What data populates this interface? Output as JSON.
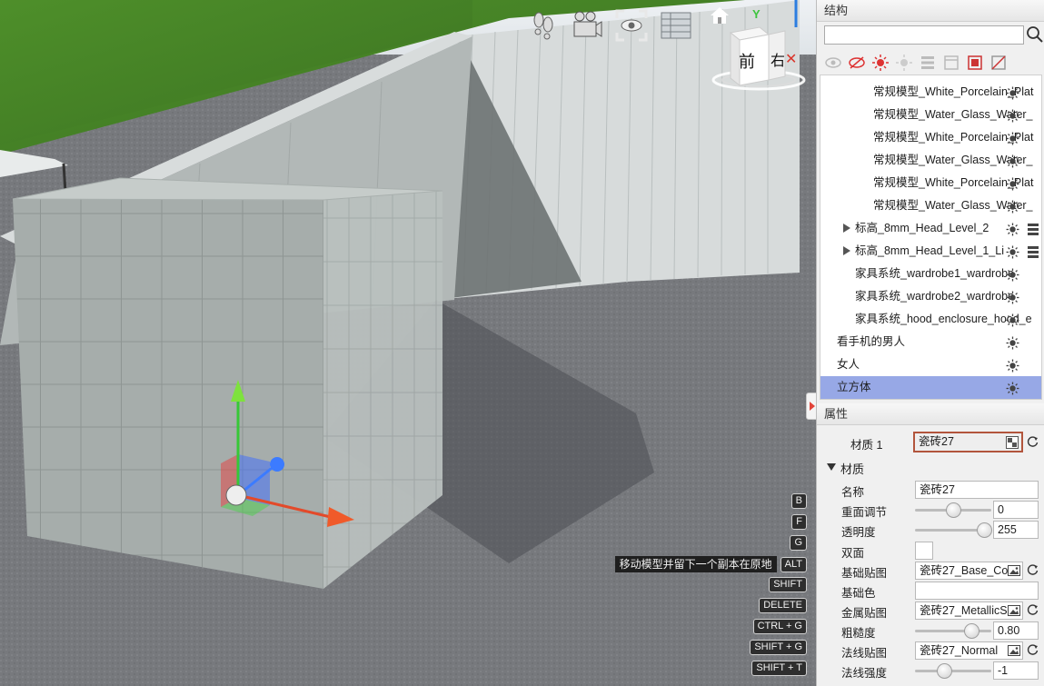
{
  "viewport": {
    "nav_cube": {
      "front_label": "前",
      "right_label": "右",
      "axis_label": "Y"
    },
    "tools": [
      "footprints-icon",
      "camera-icon",
      "eye-view-icon",
      "grid-panel-icon",
      "home-icon"
    ],
    "shortcut_hint": "移动模型并留下一个副本在原地",
    "shortcuts": [
      "B",
      "F",
      "G",
      "ALT",
      "SHIFT",
      "DELETE",
      "CTRL + G",
      "SHIFT + G",
      "SHIFT + T"
    ]
  },
  "structure": {
    "title": "结构",
    "search": {
      "value": "",
      "placeholder": ""
    },
    "toolbar": [
      "eye-icon",
      "eye-off-icon",
      "sun-red-icon",
      "sun-icon",
      "list-icon",
      "window-icon",
      "frame-red-icon",
      "frame-off-icon"
    ],
    "items": [
      {
        "label": "常规模型_White_Porcelain_Plat",
        "indent": 2
      },
      {
        "label": "常规模型_Water_Glass_Water_",
        "indent": 2
      },
      {
        "label": "常规模型_White_Porcelain_Plat",
        "indent": 2
      },
      {
        "label": "常规模型_Water_Glass_Water_",
        "indent": 2
      },
      {
        "label": "常规模型_White_Porcelain_Plat",
        "indent": 2
      },
      {
        "label": "常规模型_Water_Glass_Water_",
        "indent": 2
      },
      {
        "label": "标高_8mm_Head_Level_2",
        "indent": 1,
        "expandable": true
      },
      {
        "label": "标高_8mm_Head_Level_1_Li",
        "indent": 1,
        "expandable": true
      },
      {
        "label": "家具系统_wardrobe1_wardrobe",
        "indent": 1
      },
      {
        "label": "家具系统_wardrobe2_wardrobe",
        "indent": 1
      },
      {
        "label": "家具系统_hood_enclosure_hood_e",
        "indent": 1
      },
      {
        "label": "看手机的男人",
        "indent": 0
      },
      {
        "label": "女人",
        "indent": 0
      },
      {
        "label": "立方体",
        "indent": 0,
        "selected": true
      }
    ]
  },
  "attributes": {
    "title": "属性",
    "material_slot": {
      "label": "材质 1",
      "value": "瓷砖27"
    },
    "material_section": "材质",
    "name": {
      "label": "名称",
      "value": "瓷砖27"
    },
    "repeat": {
      "label": "重面调节",
      "value": "0",
      "slider": 0.5
    },
    "opacity": {
      "label": "透明度",
      "value": "255",
      "slider": 1.0
    },
    "double_sided": {
      "label": "双面"
    },
    "base_map": {
      "label": "基础贴图",
      "value": "瓷砖27_Base_Co"
    },
    "base_color": {
      "label": "基础色"
    },
    "metal_map": {
      "label": "金属贴图",
      "value": "瓷砖27_MetallicS"
    },
    "roughness": {
      "label": "粗糙度",
      "value": "0.80",
      "slider": 0.8
    },
    "normal_map": {
      "label": "法线贴图",
      "value": "瓷砖27_Normal"
    },
    "normal_strength": {
      "label": "法线强度",
      "value": "-1",
      "slider": 0.35
    }
  }
}
